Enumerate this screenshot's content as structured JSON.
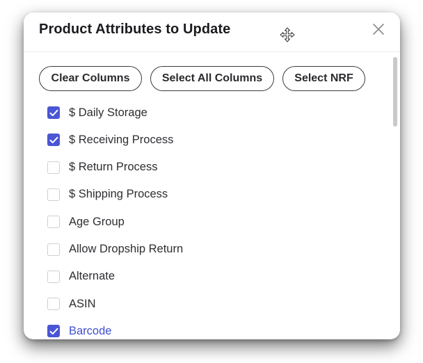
{
  "modal": {
    "title": "Product Attributes to Update"
  },
  "buttons": {
    "clear_columns": "Clear Columns",
    "select_all_columns": "Select All Columns",
    "select_nrf": "Select NRF"
  },
  "attributes": [
    {
      "label": "$ Daily Storage",
      "checked": true
    },
    {
      "label": "$ Receiving Process",
      "checked": true
    },
    {
      "label": "$ Return Process",
      "checked": false
    },
    {
      "label": "$ Shipping Process",
      "checked": false
    },
    {
      "label": "Age Group",
      "checked": false
    },
    {
      "label": "Allow Dropship Return",
      "checked": false
    },
    {
      "label": "Alternate",
      "checked": false
    },
    {
      "label": "ASIN",
      "checked": false
    },
    {
      "label": "Barcode",
      "checked": true,
      "highlighted": true
    }
  ],
  "colors": {
    "accent": "#4a56d4",
    "highlight_text": "#3f4fcf"
  },
  "icons": {
    "move": "move-arrows-icon",
    "close": "close-icon",
    "check": "checkmark-icon"
  }
}
